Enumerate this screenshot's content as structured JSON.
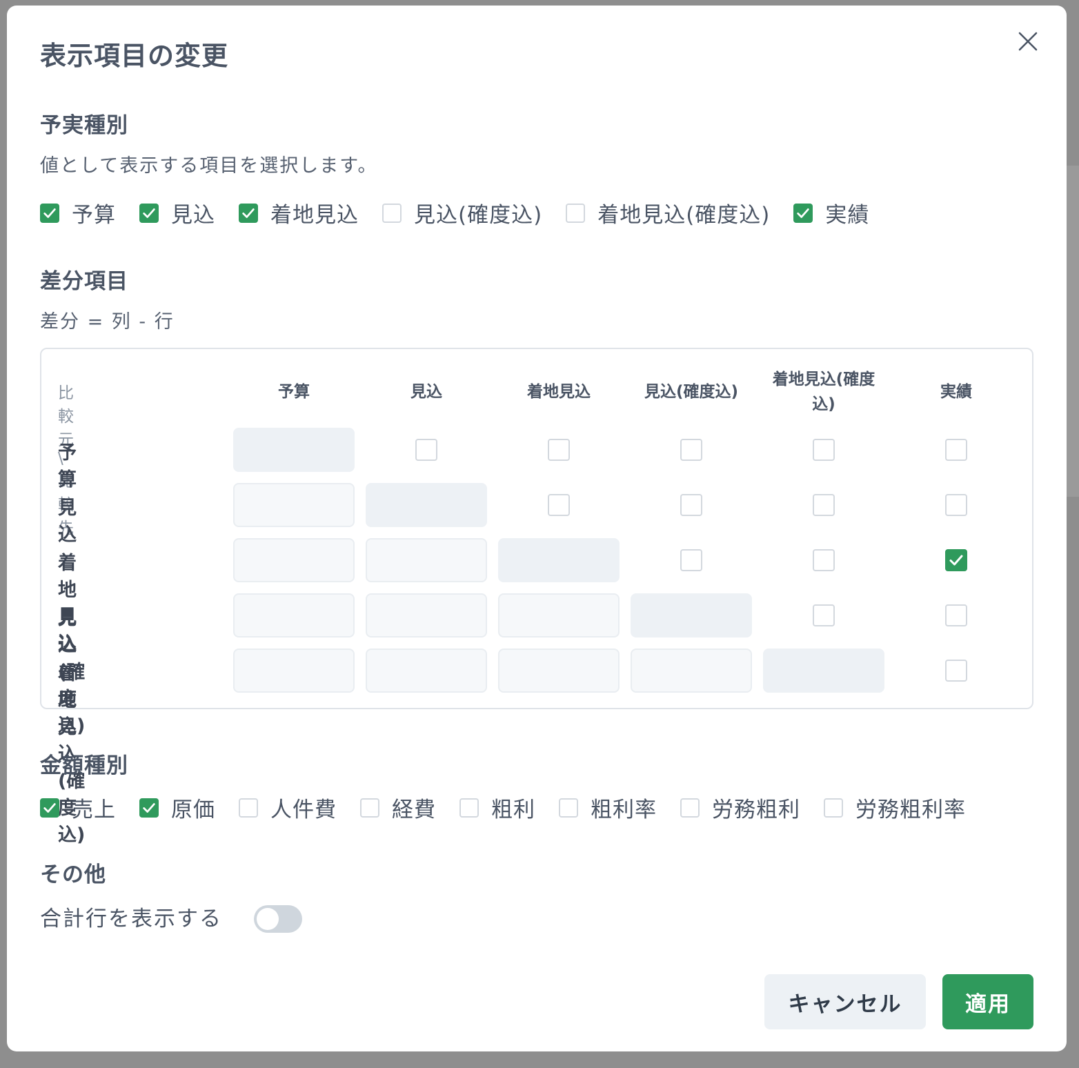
{
  "dialog": {
    "title": "表示項目の変更"
  },
  "plan_actual": {
    "heading": "予実種別",
    "description": "値として表示する項目を選択します。",
    "options": [
      {
        "label": "予算",
        "checked": true
      },
      {
        "label": "見込",
        "checked": true
      },
      {
        "label": "着地見込",
        "checked": true
      },
      {
        "label": "見込(確度込)",
        "checked": false
      },
      {
        "label": "着地見込(確度込)",
        "checked": false
      },
      {
        "label": "実績",
        "checked": true
      }
    ]
  },
  "diff": {
    "heading": "差分項目",
    "description": "差分 = 列 - 行",
    "corner_label": "比較元 \\ 比較先",
    "columns": [
      "予算",
      "見込",
      "着地見込",
      "見込(確度込)",
      "着地見込(確度込)",
      "実績"
    ],
    "rows": [
      "予算",
      "見込",
      "着地見込",
      "見込(確度込)",
      "着地見込(確度込)"
    ],
    "checked": [
      [
        2,
        5
      ]
    ]
  },
  "amount_type": {
    "heading": "金額種別",
    "options": [
      {
        "label": "売上",
        "checked": true
      },
      {
        "label": "原価",
        "checked": true
      },
      {
        "label": "人件費",
        "checked": false
      },
      {
        "label": "経費",
        "checked": false
      },
      {
        "label": "粗利",
        "checked": false
      },
      {
        "label": "粗利率",
        "checked": false
      },
      {
        "label": "労務粗利",
        "checked": false
      },
      {
        "label": "労務粗利率",
        "checked": false
      }
    ]
  },
  "other": {
    "heading": "その他",
    "show_total_row_label": "合計行を表示する",
    "show_total_row": false
  },
  "footer": {
    "cancel_label": "キャンセル",
    "apply_label": "適用"
  },
  "colors": {
    "accent": "#2f9a5c",
    "text": "#4a5464",
    "cell_disabled": "#f6f8fa",
    "cell_diagonal": "#edf1f5"
  },
  "icons": {
    "close": "close-icon",
    "check": "check-icon"
  }
}
